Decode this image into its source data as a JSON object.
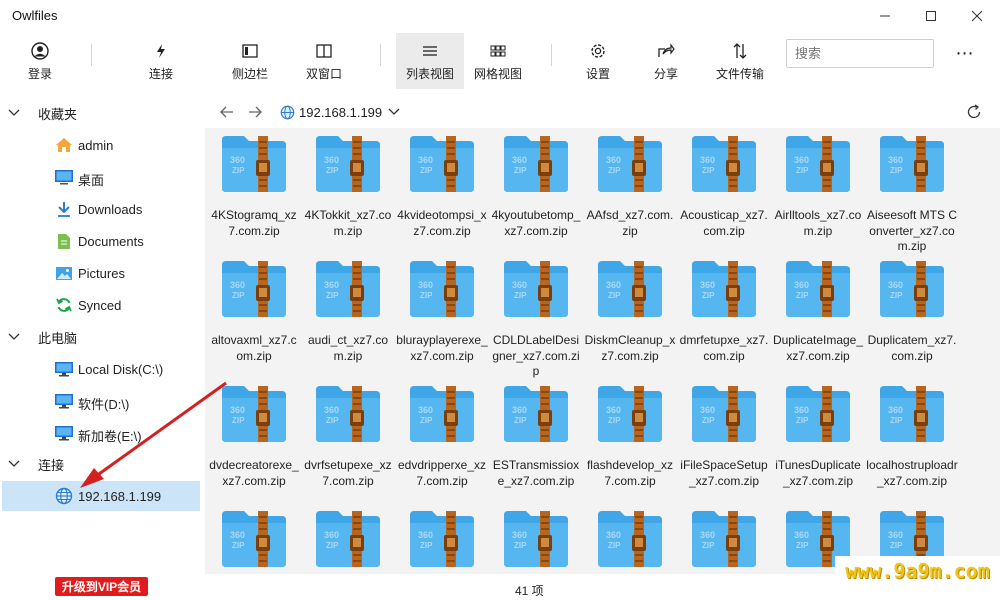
{
  "app": {
    "title": "Owlfiles"
  },
  "toolbar": {
    "items": [
      {
        "label": "登录",
        "icon": "user-icon"
      },
      {
        "label": "连接",
        "icon": "plug-icon"
      },
      {
        "label": "侧边栏",
        "icon": "sidebar-icon"
      },
      {
        "label": "双窗口",
        "icon": "dual-pane-icon"
      },
      {
        "label": "列表视图",
        "icon": "list-view-icon",
        "active": true
      },
      {
        "label": "网格视图",
        "icon": "grid-view-icon"
      },
      {
        "label": "设置",
        "icon": "gear-icon"
      },
      {
        "label": "分享",
        "icon": "share-icon"
      },
      {
        "label": "文件传输",
        "icon": "transfer-icon"
      }
    ],
    "search_placeholder": "搜索",
    "more": "⋯"
  },
  "sidebar": {
    "favorites_label": "收藏夹",
    "favorites": [
      {
        "label": "admin",
        "icon": "home-icon"
      },
      {
        "label": "桌面",
        "icon": "desktop-icon"
      },
      {
        "label": "Downloads",
        "icon": "download-icon"
      },
      {
        "label": "Documents",
        "icon": "document-icon"
      },
      {
        "label": "Pictures",
        "icon": "picture-icon"
      },
      {
        "label": "Synced",
        "icon": "sync-icon"
      }
    ],
    "computer_label": "此电脑",
    "drives": [
      {
        "label": "Local Disk(C:\\)",
        "icon": "monitor-icon"
      },
      {
        "label": "软件(D:\\)",
        "icon": "monitor-icon"
      },
      {
        "label": "新加卷(E:\\)",
        "icon": "monitor-icon"
      }
    ],
    "connections_label": "连接",
    "connections": [
      {
        "label": "192.168.1.199",
        "icon": "globe-icon",
        "selected": true
      }
    ],
    "vip_label": "升级到VIP会员"
  },
  "address": {
    "path": "192.168.1.199"
  },
  "files": [
    "4KStogramq_xz7.com.zip",
    "4KTokkit_xz7.com.zip",
    "4kvideotompsi_xz7.com.zip",
    "4kyoutubetomp_xz7.com.zip",
    "AAfsd_xz7.com.zip",
    "Acousticap_xz7.com.zip",
    "Airlltools_xz7.com.zip",
    "Aiseesoft MTS Converter_xz7.com.zip",
    "altovaxml_xz7.com.zip",
    "audi_ct_xz7.com.zip",
    "blurayplayerexe_xz7.com.zip",
    "CDLDLabelDesigner_xz7.com.zip",
    "DiskmCleanup_xz7.com.zip",
    "dmrfetupxe_xz7.com.zip",
    "DuplicateImage_xz7.com.zip",
    "Duplicatem_xz7.com.zip",
    "dvdecreatorexe_xz7.com.zip",
    "dvrfsetupexe_xz7.com.zip",
    "edvdripperxe_xz7.com.zip",
    "ESTransmissioxe_xz7.com.zip",
    "flashdevelop_xz7.com.zip",
    "iFileSpaceSetup_xz7.com.zip",
    "iTunesDuplicate_xz7.com.zip",
    "localhostruploadr_xz7.com.zip",
    "",
    "",
    "",
    "",
    "",
    "",
    "",
    ""
  ],
  "zip_icon": {
    "badge": "360",
    "type": "ZIP"
  },
  "status": {
    "count": "41 项"
  },
  "watermark": "www.9a9m.com",
  "colors": {
    "selected": "#cce4f7",
    "folder_blue": "#3fa6e8",
    "zipper_brown": "#b8651f",
    "vip_red": "#e21c1c"
  }
}
